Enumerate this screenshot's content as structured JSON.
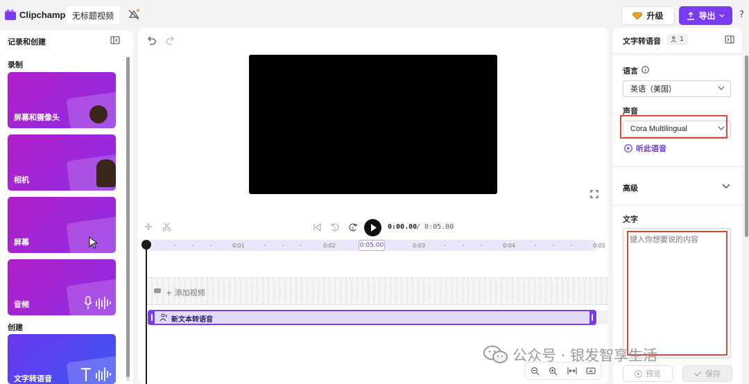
{
  "header": {
    "app_name": "Clipchamp",
    "project_title": "无标题视频",
    "upgrade_label": "升级",
    "export_label": "导出",
    "help_label": "?"
  },
  "left_panel": {
    "title": "记录和创建",
    "section_record": "录制",
    "section_create": "创建",
    "cards": [
      {
        "label": "屏幕和摄像头"
      },
      {
        "label": "相机"
      },
      {
        "label": "屏幕"
      },
      {
        "label": "音频"
      },
      {
        "label": "文字转语音"
      }
    ]
  },
  "timeline": {
    "current_time": "0:00.00",
    "total_time": "/ 0:05.00",
    "ticks": [
      "0:01",
      "0:02",
      "0:03",
      "0:04",
      "0:05"
    ],
    "badge_time": "0:05.00",
    "add_video_label": "+ 添加视频",
    "clip_label": "新文本转语音"
  },
  "right_panel": {
    "title": "文字转语音",
    "badge_count": "1",
    "language_label": "语言",
    "language_value": "英语（美国）",
    "voice_label": "声音",
    "voice_value": "Cora Multilingual",
    "listen_label": "听此语音",
    "advanced_label": "高级",
    "text_label": "文字",
    "text_placeholder": "键入你想要说的内容",
    "preview_label": "预览",
    "save_label": "保存"
  },
  "watermark": {
    "text": "公众号 · 银发智享生活"
  },
  "colors": {
    "accent": "#7a3cf0",
    "highlight": "#e0453a"
  }
}
